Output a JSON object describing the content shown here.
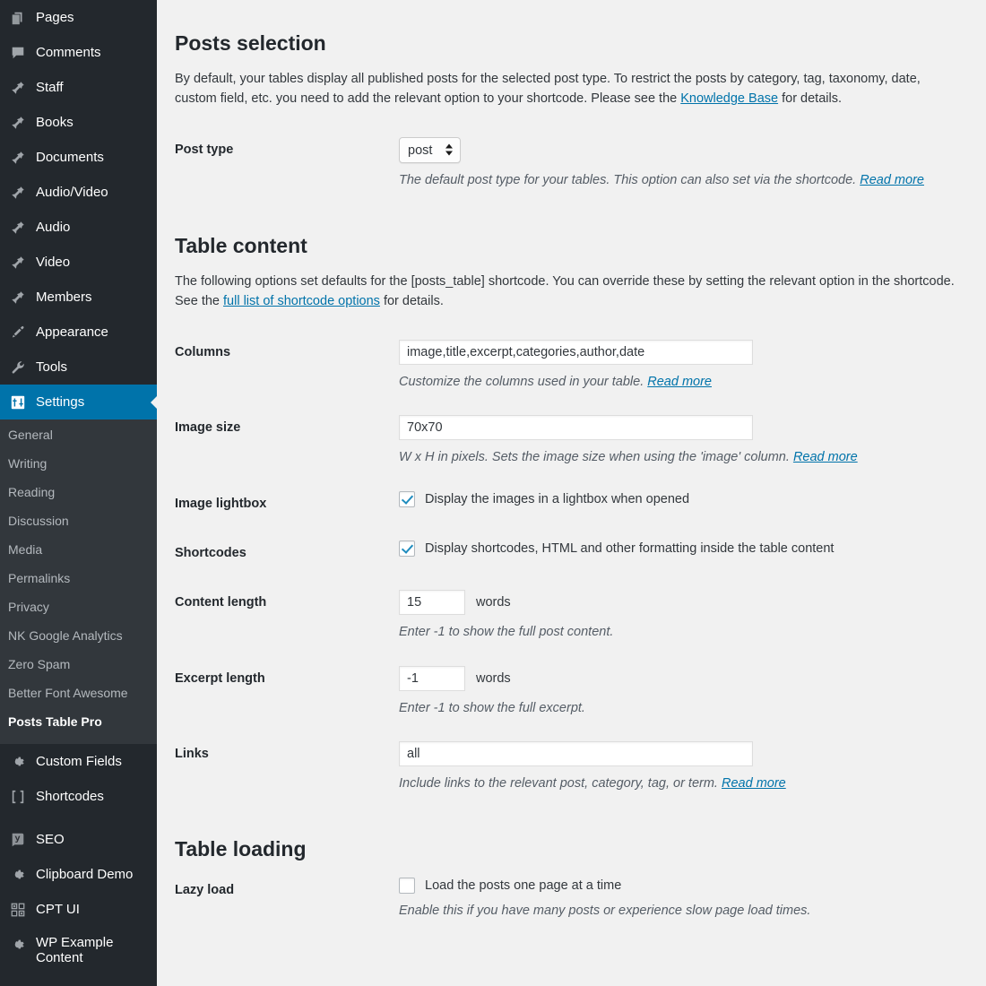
{
  "sidebar": {
    "menu": [
      {
        "label": "Pages",
        "icon": "pages-icon",
        "active": false
      },
      {
        "label": "Comments",
        "icon": "comments-icon",
        "active": false
      },
      {
        "label": "Staff",
        "icon": "pin-icon",
        "active": false
      },
      {
        "label": "Books",
        "icon": "pin-icon",
        "active": false
      },
      {
        "label": "Documents",
        "icon": "pin-icon",
        "active": false
      },
      {
        "label": "Audio/Video",
        "icon": "pin-icon",
        "active": false
      },
      {
        "label": "Audio",
        "icon": "pin-icon",
        "active": false
      },
      {
        "label": "Video",
        "icon": "pin-icon",
        "active": false
      },
      {
        "label": "Members",
        "icon": "pin-icon",
        "active": false
      },
      {
        "label": "Appearance",
        "icon": "paintbrush-icon",
        "active": false
      },
      {
        "label": "Tools",
        "icon": "wrench-icon",
        "active": false
      },
      {
        "label": "Settings",
        "icon": "settings-sliders-icon",
        "active": true
      }
    ],
    "submenu": [
      {
        "label": "General",
        "current": false
      },
      {
        "label": "Writing",
        "current": false
      },
      {
        "label": "Reading",
        "current": false
      },
      {
        "label": "Discussion",
        "current": false
      },
      {
        "label": "Media",
        "current": false
      },
      {
        "label": "Permalinks",
        "current": false
      },
      {
        "label": "Privacy",
        "current": false
      },
      {
        "label": "NK Google Analytics",
        "current": false
      },
      {
        "label": "Zero Spam",
        "current": false
      },
      {
        "label": "Better Font Awesome",
        "current": false
      },
      {
        "label": "Posts Table Pro",
        "current": true
      }
    ],
    "menu_lower": [
      {
        "label": "Custom Fields",
        "icon": "gear-icon"
      },
      {
        "label": "Shortcodes",
        "icon": "brackets-icon"
      },
      {
        "label": "SEO",
        "icon": "yoast-seo-icon"
      },
      {
        "label": "Clipboard Demo",
        "icon": "gear-icon"
      },
      {
        "label": "CPT UI",
        "icon": "grid-icon"
      },
      {
        "label": "WP Example Content",
        "icon": "gear-icon"
      }
    ]
  },
  "colors": {
    "sidebar_bg": "#23282d",
    "submenu_bg": "#32373c",
    "accent_blue": "#0073aa",
    "link_blue": "#0073aa",
    "checkbox_check": "#1e8cbe",
    "content_bg": "#f1f1f1"
  },
  "sections": {
    "posts_selection": {
      "title": "Posts selection",
      "description_part1": "By default, your tables display all published posts for the selected post type. To restrict the posts by category, tag, taxonomy, date, custom field, etc. you need to add the relevant option to your shortcode. Please see the ",
      "description_link": "Knowledge Base",
      "description_part2": " for details."
    },
    "table_content": {
      "title": "Table content",
      "description_part1": "The following options set defaults for the [posts_table] shortcode. You can override these by setting the relevant option in the shortcode. See the ",
      "description_link": "full list of shortcode options",
      "description_part2": " for details."
    },
    "table_loading": {
      "title": "Table loading"
    }
  },
  "fields": {
    "post_type": {
      "label": "Post type",
      "value": "post",
      "options": [
        "post"
      ],
      "desc_part1": "The default post type for your tables. This option can also set via the shortcode. ",
      "desc_link": "Read more"
    },
    "columns": {
      "label": "Columns",
      "value": "image,title,excerpt,categories,author,date",
      "desc_part1": "Customize the columns used in your table. ",
      "desc_link": "Read more"
    },
    "image_size": {
      "label": "Image size",
      "value": "70x70",
      "desc_part1": "W x H in pixels. Sets the image size when using the 'image' column. ",
      "desc_link": "Read more"
    },
    "image_lightbox": {
      "label": "Image lightbox",
      "checkbox_label": "Display the images in a lightbox when opened",
      "checked": true
    },
    "shortcodes": {
      "label": "Shortcodes",
      "checkbox_label": "Display shortcodes, HTML and other formatting inside the table content",
      "checked": true
    },
    "content_length": {
      "label": "Content length",
      "value": "15",
      "unit": "words",
      "desc": "Enter -1 to show the full post content."
    },
    "excerpt_length": {
      "label": "Excerpt length",
      "value": "-1",
      "unit": "words",
      "desc": "Enter -1 to show the full excerpt."
    },
    "links": {
      "label": "Links",
      "value": "all",
      "desc_part1": "Include links to the relevant post, category, tag, or term. ",
      "desc_link": "Read more"
    },
    "lazy_load": {
      "label": "Lazy load",
      "checkbox_label": "Load the posts one page at a time",
      "checked": false,
      "desc": "Enable this if you have many posts or experience slow page load times."
    }
  }
}
